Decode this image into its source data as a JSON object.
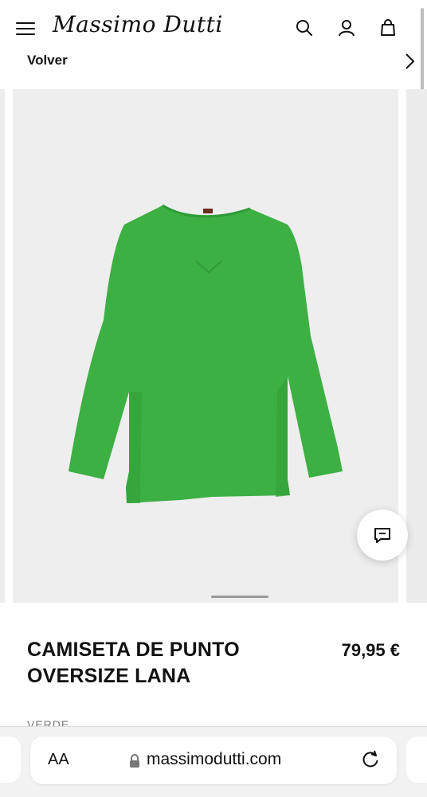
{
  "header": {
    "brand": "Massimo Dutti",
    "menu_icon": "hamburger-menu-icon",
    "search_icon": "search-icon",
    "account_icon": "user-icon",
    "bag_icon": "shopping-bag-icon",
    "back_label": "Volver",
    "next_icon": "chevron-right-icon"
  },
  "product": {
    "name": "CAMISETA DE PUNTO OVERSIZE LANA",
    "price": "79,95 €",
    "color": "VERDE",
    "image_icon": "green-knit-sweater-image",
    "accent": "#3cb043"
  },
  "chat": {
    "icon": "chat-bubble-icon"
  },
  "browser": {
    "text_size_label": "AA",
    "url": "massimodutti.com",
    "lock_icon": "lock-icon",
    "reload_icon": "reload-icon"
  }
}
